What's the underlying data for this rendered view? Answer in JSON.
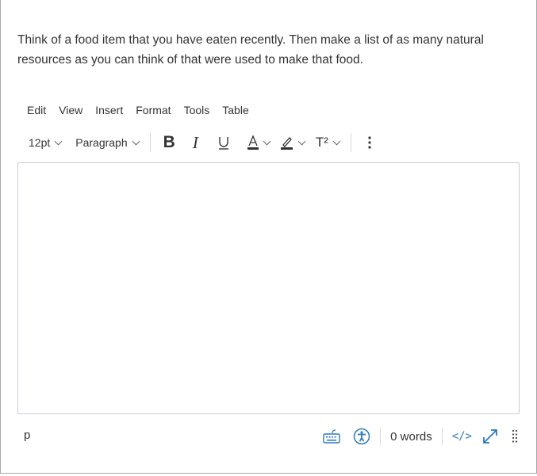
{
  "prompt": {
    "text": "Think of a food item that you have eaten recently. Then make a list of as many natural resources as you can think of that were used to make that food."
  },
  "menubar": {
    "items": [
      "Edit",
      "View",
      "Insert",
      "Format",
      "Tools",
      "Table"
    ]
  },
  "toolbar": {
    "font_size": "12pt",
    "block_format": "Paragraph",
    "bold_icon": "B",
    "italic_icon": "I",
    "underline_icon": "U",
    "text_color_icon": "A",
    "superscript_icon": "T²"
  },
  "editor": {
    "content": ""
  },
  "statusbar": {
    "element_path": "p",
    "word_count": "0 words",
    "html_editor_label": "</>"
  },
  "colors": {
    "accent": "#2b7abc",
    "border": "#c7cdd1",
    "text": "#333333"
  }
}
